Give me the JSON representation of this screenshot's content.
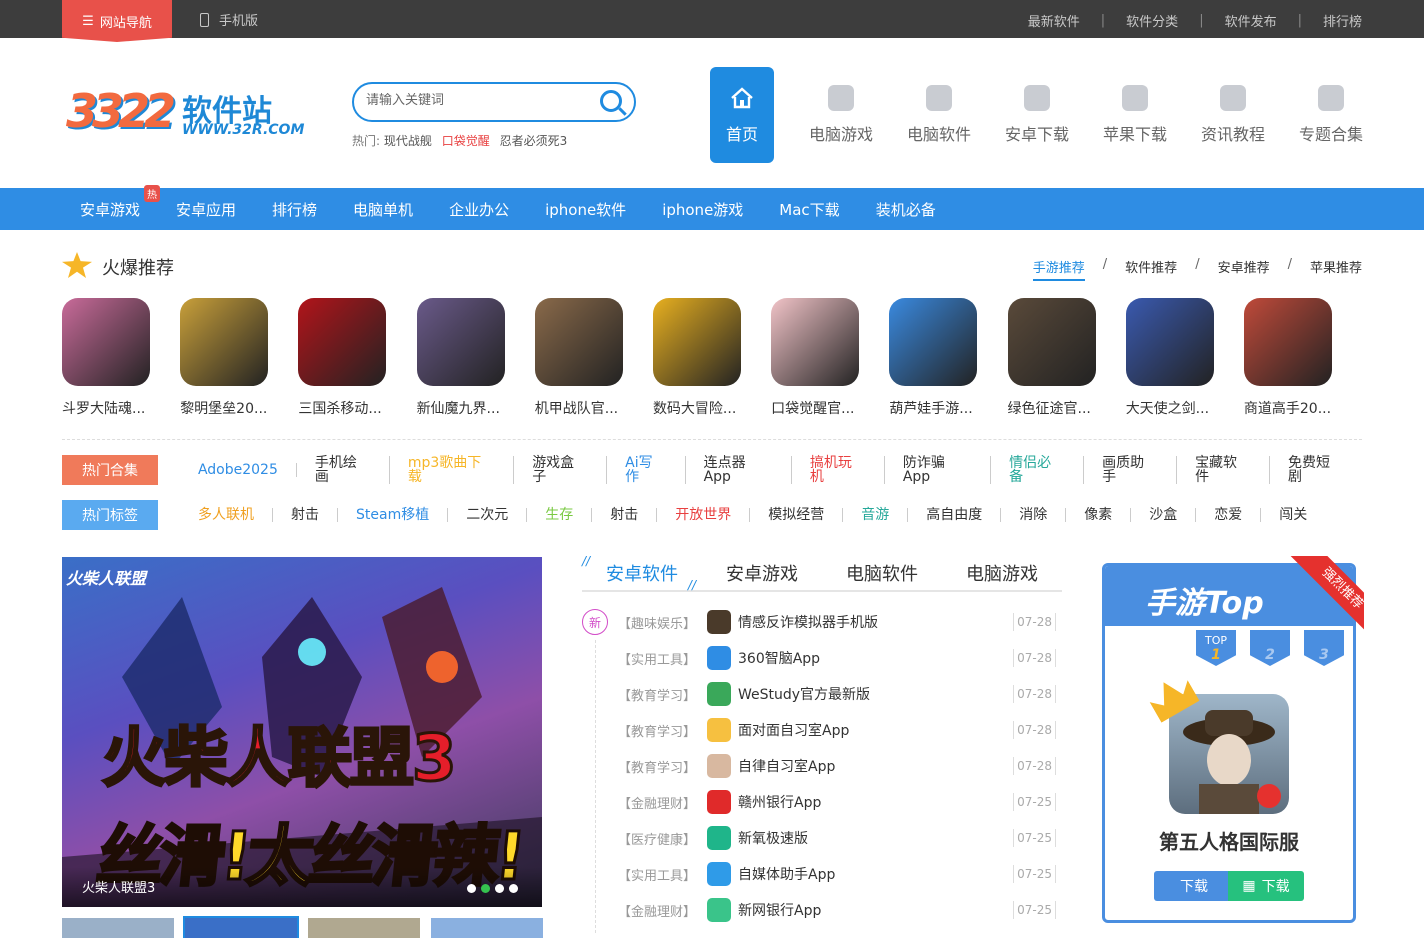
{
  "topbar": {
    "nav_button": "网站导航",
    "mobile": "手机版",
    "links": [
      "最新软件",
      "软件分类",
      "软件发布",
      "排行榜"
    ]
  },
  "logo": {
    "name": "软件站",
    "number": "3322",
    "url": "WWW.32R.COM"
  },
  "search": {
    "placeholder": "请输入关键词",
    "hot_label": "热门:",
    "hot_words": [
      "现代战舰",
      "口袋觉醒",
      "忍者必须死3"
    ]
  },
  "main_nav": [
    {
      "label": "首页",
      "icon": "home-icon",
      "active": true
    },
    {
      "label": "电脑游戏",
      "icon": "gamepad-icon"
    },
    {
      "label": "电脑软件",
      "icon": "cube-icon"
    },
    {
      "label": "安卓下载",
      "icon": "android-icon"
    },
    {
      "label": "苹果下载",
      "icon": "apple-icon"
    },
    {
      "label": "资讯教程",
      "icon": "book-icon"
    },
    {
      "label": "专题合集",
      "icon": "box-icon"
    }
  ],
  "blue_nav": {
    "items": [
      "安卓游戏",
      "安卓应用",
      "排行榜",
      "电脑单机",
      "企业办公",
      "iphone软件",
      "iphone游戏",
      "Mac下载",
      "装机必备"
    ],
    "hot_badge": "热"
  },
  "recommend": {
    "title": "火爆推荐",
    "tabs": [
      "手游推荐",
      "软件推荐",
      "安卓推荐",
      "苹果推荐"
    ],
    "games": [
      {
        "name": "斗罗大陆魂...",
        "color": "#c96b9a"
      },
      {
        "name": "黎明堡垒20...",
        "color": "#c9a03a"
      },
      {
        "name": "三国杀移动...",
        "color": "#b2141a"
      },
      {
        "name": "新仙魔九界...",
        "color": "#6a5a8a"
      },
      {
        "name": "机甲战队官...",
        "color": "#8a6a4a"
      },
      {
        "name": "数码大冒险...",
        "color": "#e8b020"
      },
      {
        "name": "口袋觉醒官...",
        "color": "#f2c4c8"
      },
      {
        "name": "葫芦娃手游...",
        "color": "#3a8ae0"
      },
      {
        "name": "绿色征途官...",
        "color": "#5a4a3a"
      },
      {
        "name": "大天使之剑...",
        "color": "#3a5ab0"
      },
      {
        "name": "商道高手20...",
        "color": "#c04a3a"
      }
    ]
  },
  "hot_collections": {
    "label": "热门合集",
    "label_color": "#f07a5a",
    "items": [
      {
        "text": "Adobe2025",
        "color": "#2f8de4"
      },
      {
        "text": "手机绘画",
        "color": "#333333"
      },
      {
        "text": "mp3歌曲下载",
        "color": "#f6b628"
      },
      {
        "text": "游戏盒子",
        "color": "#333333"
      },
      {
        "text": "Ai写作",
        "color": "#2f8de4"
      },
      {
        "text": "连点器App",
        "color": "#333333"
      },
      {
        "text": "搞机玩机",
        "color": "#e84040"
      },
      {
        "text": "防诈骗App",
        "color": "#333333"
      },
      {
        "text": "情侣必备",
        "color": "#26a89a"
      },
      {
        "text": "画质助手",
        "color": "#333333"
      },
      {
        "text": "宝藏软件",
        "color": "#333333"
      },
      {
        "text": "免费短剧",
        "color": "#333333"
      }
    ]
  },
  "hot_tags": {
    "label": "热门标签",
    "label_color": "#5aaaf0",
    "items": [
      {
        "text": "多人联机",
        "color": "#f0a020"
      },
      {
        "text": "射击",
        "color": "#333333"
      },
      {
        "text": "Steam移植",
        "color": "#2f8de4"
      },
      {
        "text": "二次元",
        "color": "#333333"
      },
      {
        "text": "生存",
        "color": "#7ac943"
      },
      {
        "text": "射击",
        "color": "#333333"
      },
      {
        "text": "开放世界",
        "color": "#e84040"
      },
      {
        "text": "模拟经营",
        "color": "#333333"
      },
      {
        "text": "音游",
        "color": "#26a89a"
      },
      {
        "text": "高自由度",
        "color": "#333333"
      },
      {
        "text": "消除",
        "color": "#333333"
      },
      {
        "text": "像素",
        "color": "#333333"
      },
      {
        "text": "沙盒",
        "color": "#333333"
      },
      {
        "text": "恋爱",
        "color": "#333333"
      },
      {
        "text": "闯关",
        "color": "#333333"
      }
    ]
  },
  "banner": {
    "corner_logo": "火柴人联盟",
    "headline": "火柴人联盟3",
    "subline": "丝滑!太丝滑辣!",
    "caption": "火柴人联盟3",
    "active_dot": 1,
    "dot_count": 4
  },
  "list_tabs": [
    "安卓软件",
    "安卓游戏",
    "电脑软件",
    "电脑游戏"
  ],
  "new_badge": "新",
  "list": [
    {
      "cat": "【趣味娱乐】",
      "name": "情感反诈模拟器手机版",
      "date": "07-28",
      "color": "#4a3a2a"
    },
    {
      "cat": "【实用工具】",
      "name": "360智脑App",
      "date": "07-28",
      "color": "#2f8de4"
    },
    {
      "cat": "【教育学习】",
      "name": "WeStudy官方最新版",
      "date": "07-28",
      "color": "#3aa85a"
    },
    {
      "cat": "【教育学习】",
      "name": "面对面自习室App",
      "date": "07-28",
      "color": "#f6c040"
    },
    {
      "cat": "【教育学习】",
      "name": "自律自习室App",
      "date": "07-28",
      "color": "#d8b8a0"
    },
    {
      "cat": "【金融理财】",
      "name": "赣州银行App",
      "date": "07-25",
      "color": "#e02a2a"
    },
    {
      "cat": "【医疗健康】",
      "name": "新氧极速版",
      "date": "07-25",
      "color": "#1fb58a"
    },
    {
      "cat": "【实用工具】",
      "name": "自媒体助手App",
      "date": "07-25",
      "color": "#2f9be8"
    },
    {
      "cat": "【金融理财】",
      "name": "新网银行App",
      "date": "07-25",
      "color": "#3ac48a"
    }
  ],
  "top_box": {
    "title": "手游Top",
    "ribbon": "强烈推荐",
    "rank_top": "TOP",
    "ranks": [
      "1",
      "2",
      "3"
    ],
    "featured_name": "第五人格国际服",
    "ios_btn": "下载",
    "android_btn": "下载"
  }
}
